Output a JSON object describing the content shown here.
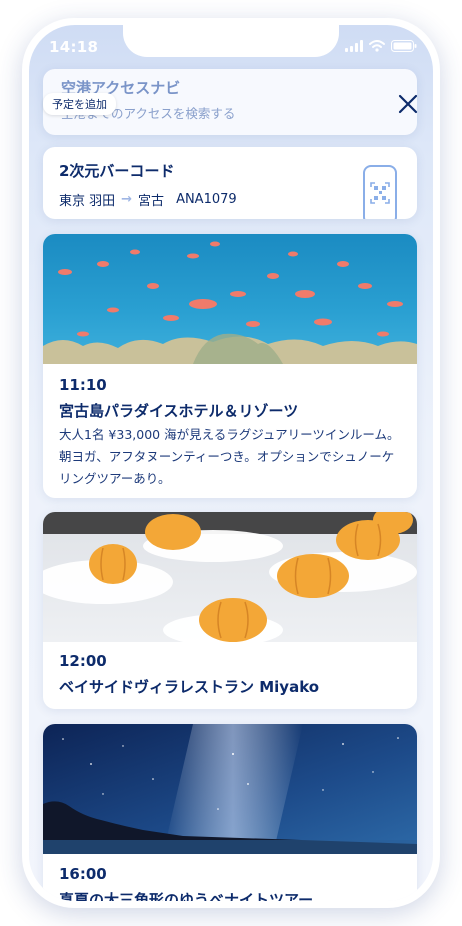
{
  "status": {
    "time": "14:18"
  },
  "access": {
    "title": "空港アクセスナビ",
    "subtitle": "空港までのアクセスを検索する",
    "add_chip": "予定を追加"
  },
  "barcode": {
    "title": "2次元バーコード",
    "from": "東京 羽田",
    "to": "宮古",
    "flight": "ANA1079"
  },
  "events": [
    {
      "time": "11:10",
      "title": "宮古島パラダイスホテル＆リゾーツ",
      "description": "大人1名 ¥33,000 海が見えるラグジュアリーツインルーム。朝ヨガ、アフタヌーンティーつき。オプションでシュノーケリングツアーあり。"
    },
    {
      "time": "12:00",
      "title": "ベイサイドヴィラレストラン Miyako"
    },
    {
      "time": "16:00",
      "title": "真夏の大三角形のゆうべナイトツアー"
    }
  ],
  "colors": {
    "navy": "#0d2b6b",
    "accent": "#8aaee8"
  }
}
